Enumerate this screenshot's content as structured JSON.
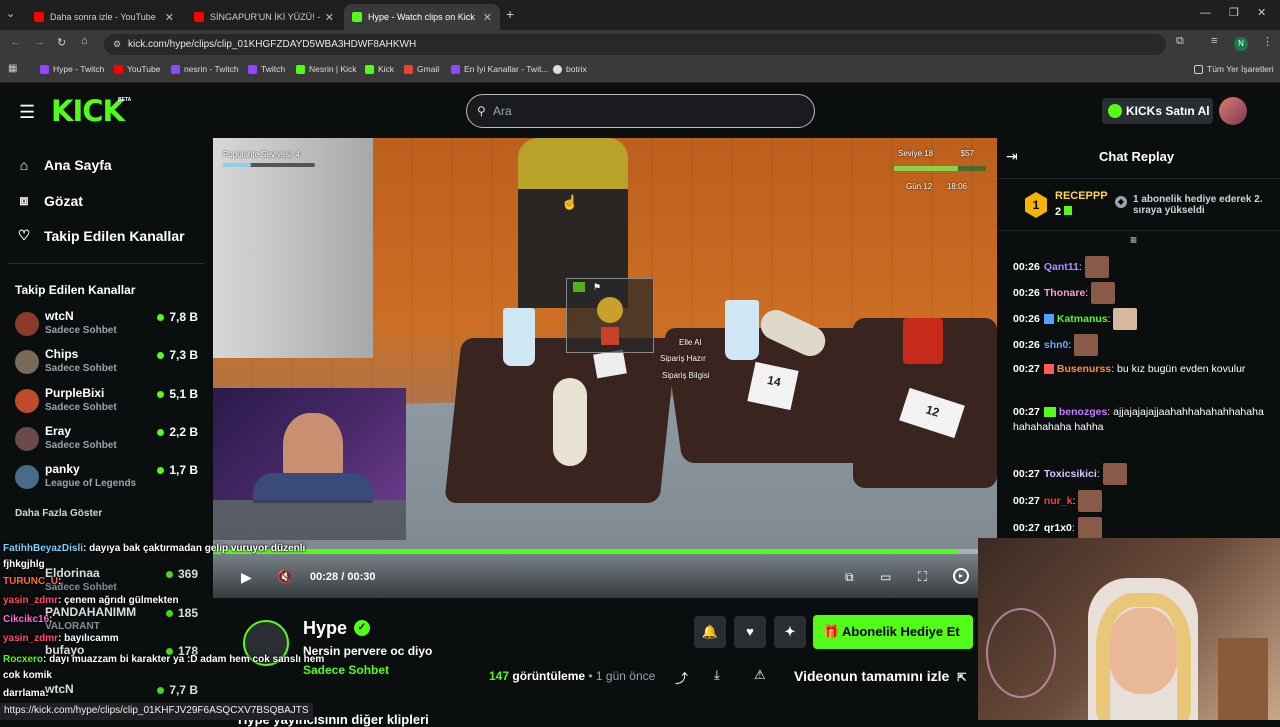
{
  "browser": {
    "tabs": [
      {
        "title": "Daha sonra izle - YouTube",
        "color": "#ff0000"
      },
      {
        "title": "SİNGAPUR'UN İKİ YÜZÜ! - YouT",
        "color": "#ff0000"
      },
      {
        "title": "Hype - Watch clips on Kick",
        "color": "#53fc18"
      }
    ],
    "url": "kick.com/hype/clips/clip_01KHGFZDAYD5WBA3HDWF8AHKWH",
    "bookmarks": [
      "Hype - Twitch",
      "YouTube",
      "nesrin - Twitch",
      "Twitch",
      "Nesrin | Kick",
      "Kick",
      "Gmail",
      "En İyi Kanallar - Twit...",
      "botrix"
    ],
    "all_bookmarks": "Tüm Yer İşaretleri",
    "profile_initial": "N"
  },
  "header": {
    "logo": "KICK",
    "beta": "BETA",
    "search_placeholder": "Ara",
    "buy_kicks": "KICKs Satın Al"
  },
  "sidebar": {
    "nav": [
      "Ana Sayfa",
      "Gözat",
      "Takip Edilen Kanallar"
    ],
    "followed_title": "Takip Edilen Kanallar",
    "channels": [
      {
        "name": "wtcN",
        "sub": "Sadece Sohbet",
        "viewers": "7,8 B",
        "color": "#8a3a2a"
      },
      {
        "name": "Chips",
        "sub": "Sadece Sohbet",
        "viewers": "7,3 B",
        "color": "#7a6a5a"
      },
      {
        "name": "PurpleBixi",
        "sub": "Sadece Sohbet",
        "viewers": "5,1 B",
        "color": "#c04a2a"
      },
      {
        "name": "Eray",
        "sub": "Sadece Sohbet",
        "viewers": "2,2 B",
        "color": "#6a4a4a"
      },
      {
        "name": "panky",
        "sub": "League of Legends",
        "viewers": "1,7 B",
        "color": "#4a6a8a"
      }
    ],
    "show_more": "Daha Fazla Göster",
    "hidden_channels": [
      {
        "name": "Eldorinaa",
        "sub": "Sadece Sohbet",
        "viewers": "369"
      },
      {
        "name": "PANDAHANIMM",
        "sub": "VALORANT",
        "viewers": "185"
      },
      {
        "name": "bufayo",
        "sub": "",
        "viewers": "178"
      },
      {
        "name": "wtcN",
        "sub": "Sadece Sohbet",
        "viewers": "7,7 B"
      }
    ]
  },
  "video": {
    "popularity": "Popülarite Seviyesi: 4",
    "level": "Seviye 18",
    "money": "$57",
    "day": "Gün 12",
    "time": "18:06",
    "prompt1": "Elle Al",
    "prompt2": "Sipariş Hazır",
    "prompt3": "Sipariş Bilgisi",
    "ticket1": "14",
    "ticket2": "12",
    "current": "00:28",
    "separator": "/",
    "duration": "00:30",
    "progress": 0.95
  },
  "channel_info": {
    "name": "Hype",
    "clip_title": "Nersin pervere oc diyo",
    "category": "Sadece Sohbet",
    "views": "147",
    "views_label": "görüntüleme",
    "ago": "• 1 gün önce",
    "gift_button": "Abonelik Hediye Et",
    "watch_full": "Videonun tamamını izle",
    "more_clips": "Hype yayıncısının diğer klipleri"
  },
  "chat": {
    "title": "Chat Replay",
    "top_user": "RECEPPP",
    "top_rank": "1",
    "top_count": "2",
    "top_note": "1 abonelik hediye ederek 2. sıraya yükseldi",
    "messages": [
      {
        "t": "00:26",
        "user": "Qant11",
        "color": "#b28cff",
        "text": "",
        "emote": true
      },
      {
        "t": "00:26",
        "user": "Thonare",
        "color": "#ff9ad5",
        "text": "",
        "emote": true
      },
      {
        "t": "00:26",
        "user": "Katmanus",
        "color": "#53fc18",
        "text": "",
        "emote": true
      },
      {
        "t": "00:26",
        "user": "shn0",
        "color": "#6aa7ff",
        "text": "",
        "emote": true
      },
      {
        "t": "00:27",
        "user": "Busenurss",
        "color": "#ff8a3a",
        "text": "bu kız bugün evden kovulur",
        "emote": false
      },
      {
        "t": "00:27",
        "user": "benozges",
        "color": "#c77dff",
        "text": "ajjajajajajjaahahhahahahhahahahahahahaha hahha",
        "emote": false
      },
      {
        "t": "00:27",
        "user": "Toxicsikici",
        "color": "#d7c7ff",
        "text": "",
        "emote": true
      },
      {
        "t": "00:27",
        "user": "nur_k",
        "color": "#ff3a3a",
        "text": "",
        "emote": true
      },
      {
        "t": "00:27",
        "user": "qr1x0",
        "color": "#ffffff",
        "text": "",
        "emote": true
      }
    ]
  },
  "overlay_chat": [
    {
      "user": "FatihhBeyazDisli",
      "color": "#7ad0ff",
      "text": ": dayıya bak çaktırmadan gelip vuruyor düzenli fjhkgjhlg"
    },
    {
      "user": "TURUNC_U",
      "color": "#ff6a3a",
      "text": ":"
    },
    {
      "user": "yasin_zdmr",
      "color": "#ff4a6a",
      "text": ": çenem ağrıdı gülmekten"
    },
    {
      "user": "Cikcikc16",
      "color": "#ff6adf",
      "text": ":"
    },
    {
      "user": "yasin_zdmr",
      "color": "#ff4a6a",
      "text": ": bayılıcamm"
    },
    {
      "user": "Rocxero",
      "color": "#53fc18",
      "text": ": dayı muazzam bi karakter ya :D adam hem cok sanslı hem cok komik"
    },
    {
      "user": "darrlama",
      "color": "#ffffff",
      "text": ":"
    }
  ],
  "status_url": "https://kick.com/hype/clips/clip_01KHFJV29F6ASQCXV7BSQBAJTS"
}
